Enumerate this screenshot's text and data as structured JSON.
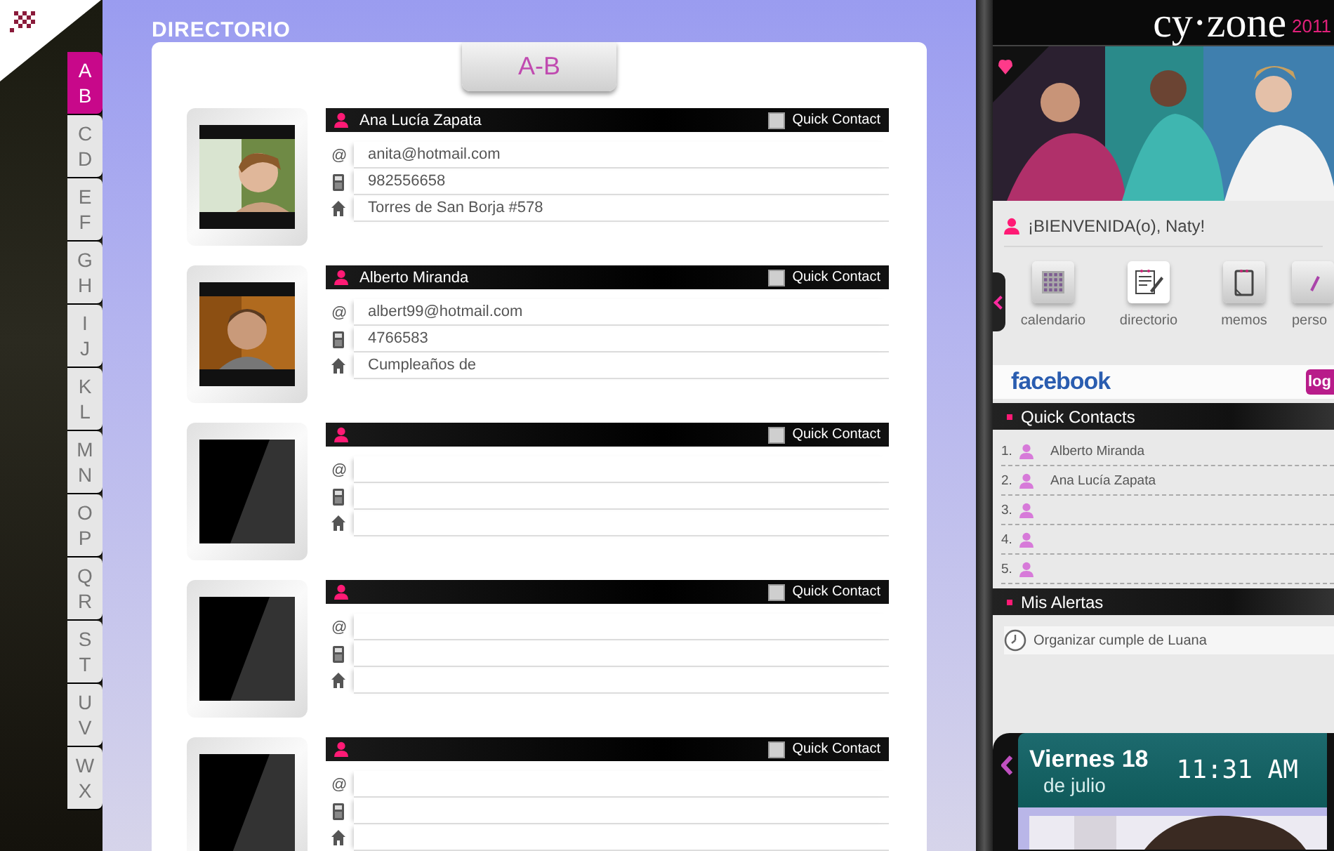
{
  "sidebar": {
    "tabs": [
      {
        "letters": [
          "A",
          "B"
        ],
        "selected": true
      },
      {
        "letters": [
          "C",
          "D"
        ],
        "selected": false
      },
      {
        "letters": [
          "E",
          "F"
        ],
        "selected": false
      },
      {
        "letters": [
          "G",
          "H"
        ],
        "selected": false
      },
      {
        "letters": [
          "I",
          "J"
        ],
        "selected": false
      },
      {
        "letters": [
          "K",
          "L"
        ],
        "selected": false
      },
      {
        "letters": [
          "M",
          "N"
        ],
        "selected": false
      },
      {
        "letters": [
          "O",
          "P"
        ],
        "selected": false
      },
      {
        "letters": [
          "Q",
          "R"
        ],
        "selected": false
      },
      {
        "letters": [
          "S",
          "T"
        ],
        "selected": false
      },
      {
        "letters": [
          "U",
          "V"
        ],
        "selected": false
      },
      {
        "letters": [
          "W",
          "X"
        ],
        "selected": false
      }
    ]
  },
  "directory": {
    "title": "DIRECTORIO",
    "section_tab": "A-B",
    "contacts": [
      {
        "has_photo": true,
        "name": "Ana Lucía Zapata",
        "quick_contact_label": "Quick Contact",
        "quick_contact": false,
        "email_mark": "@",
        "email": "anita@hotmail.com",
        "phone": "982556658",
        "address": "Torres de San Borja #578"
      },
      {
        "has_photo": true,
        "name": "Alberto Miranda",
        "quick_contact_label": "Quick Contact",
        "quick_contact": false,
        "email_mark": "@",
        "email": "albert99@hotmail.com",
        "phone": "4766583",
        "address": "Cumpleaños de"
      },
      {
        "has_photo": false,
        "quick_contact_label": "Quick Contact",
        "quick_contact": false,
        "email_mark": "@"
      },
      {
        "has_photo": false,
        "quick_contact_label": "Quick Contact",
        "quick_contact": false,
        "email_mark": "@"
      },
      {
        "has_photo": false,
        "quick_contact_label": "Quick Contact",
        "quick_contact": false,
        "email_mark": "@"
      }
    ]
  },
  "planner": {
    "logo": "cy·zone",
    "year": "2011",
    "welcome": "¡BIENVENIDA(o), Naty!",
    "apps": [
      {
        "kind": "calendar",
        "label": "calendario",
        "selected": false
      },
      {
        "kind": "notepad",
        "label": "directorio",
        "selected": true
      },
      {
        "kind": "memo",
        "label": "memos",
        "selected": false
      },
      {
        "kind": "other",
        "label": "perso",
        "selected": false
      }
    ],
    "facebook": {
      "logo": "facebook",
      "login": "log"
    },
    "quick_contacts": {
      "title": "Quick Contacts",
      "items": [
        {
          "number": "1.",
          "name": "Alberto Miranda"
        },
        {
          "number": "2.",
          "name": "Ana Lucía Zapata"
        },
        {
          "number": "3."
        },
        {
          "number": "4."
        },
        {
          "number": "5."
        }
      ]
    },
    "alerts": {
      "title": "Mis Alertas",
      "items": [
        "Organizar cumple de Luana"
      ]
    },
    "date_widget": {
      "day": "Viernes 18",
      "month": "de julio",
      "time": "11:31 AM"
    }
  }
}
